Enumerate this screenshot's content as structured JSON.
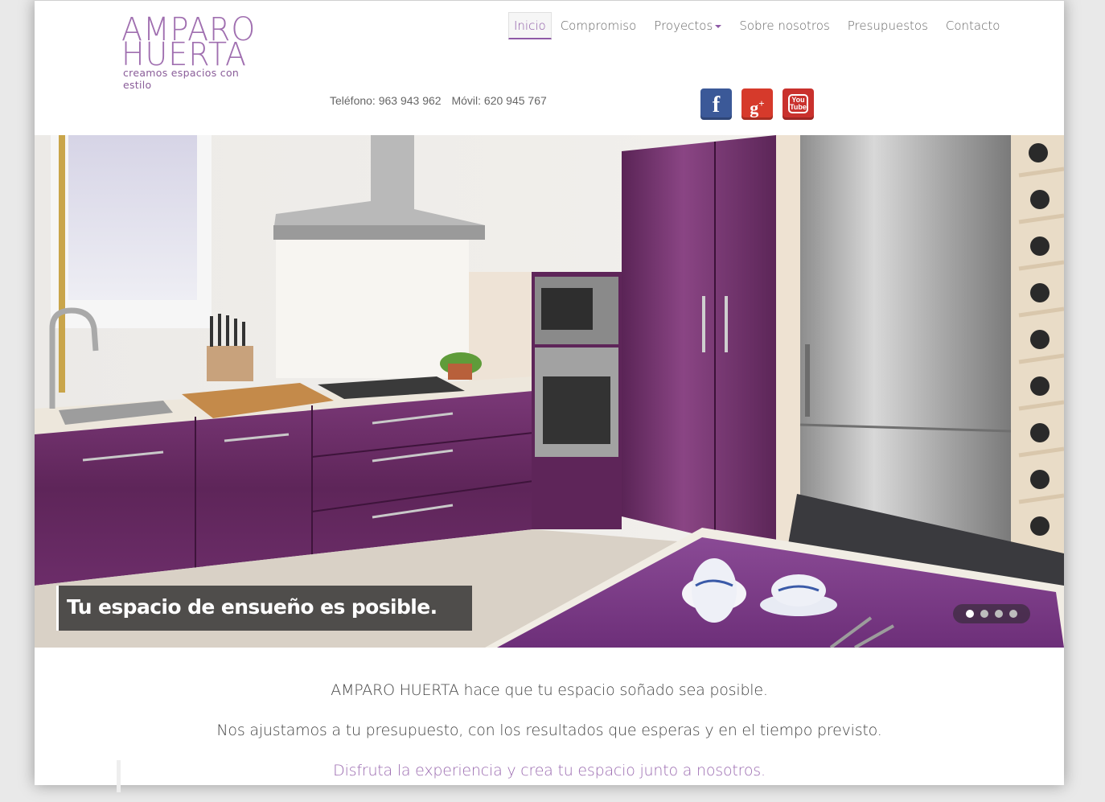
{
  "logo": {
    "line1": "AMPARO",
    "line2": "HUERTA",
    "tagline": "creamos espacios con estilo"
  },
  "nav": {
    "items": [
      {
        "label": "Inicio",
        "active": true
      },
      {
        "label": "Compromiso"
      },
      {
        "label": "Proyectos",
        "dropdown": true
      },
      {
        "label": "Sobre nosotros"
      },
      {
        "label": "Presupuestos"
      },
      {
        "label": "Contacto"
      }
    ]
  },
  "contact": {
    "phone": "Teléfono: 963 943 962",
    "mobile": "Móvil: 620 945 767"
  },
  "social": {
    "facebook": {
      "icon": "facebook-icon",
      "glyph": "f",
      "color": "#3b5998"
    },
    "googleplus": {
      "icon": "google-plus-icon",
      "glyph": "g",
      "sup": "+",
      "color": "#d63a2b"
    },
    "youtube": {
      "icon": "youtube-icon",
      "line1": "You",
      "line2": "Tube",
      "color": "#c9312d"
    }
  },
  "slider": {
    "caption": "Tu espacio de ensueño es posible.",
    "slide_count": 4,
    "active_slide": 1
  },
  "intro": {
    "line1": "AMPARO HUERTA hace que tu espacio soñado sea posible.",
    "line2": "Nos ajustamos a tu presupuesto, con los resultados que esperas y en el tiempo previsto.",
    "line3": "Disfruta la experiencia y crea tu espacio junto a nosotros."
  },
  "colors": {
    "accent": "#8e5aa6",
    "cabinet": "#6b2d68",
    "tablecloth": "#7a3a86"
  }
}
